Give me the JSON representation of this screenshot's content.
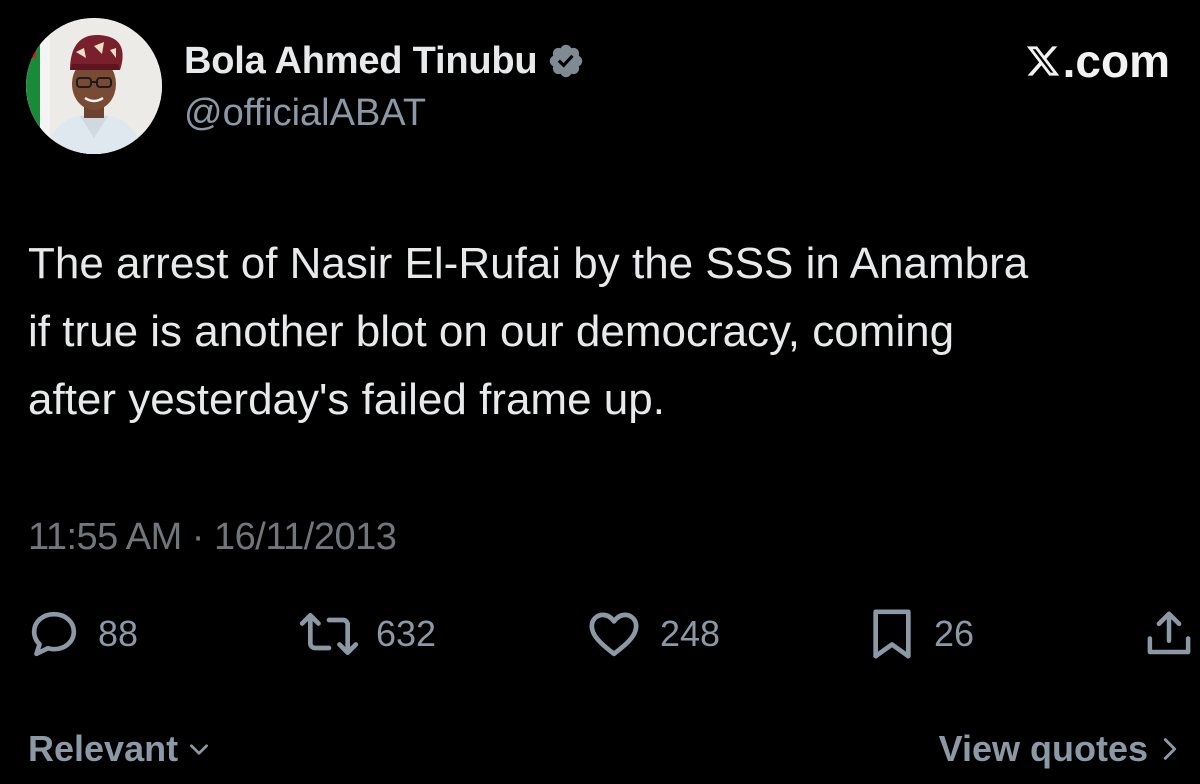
{
  "author": {
    "display_name": "Bola Ahmed Tinubu",
    "handle": "@officialABAT",
    "verified": true,
    "avatar_icon": "profile-photo"
  },
  "source": {
    "label": ".com",
    "logo_icon": "x-logo-icon"
  },
  "tweet": {
    "text": "The arrest of Nasir El-Rufai by the SSS in Anambra\nif true is another blot on our democracy, coming\nafter yesterday's failed frame up."
  },
  "meta": {
    "timestamp": "11:55 AM · 16/11/2013"
  },
  "actions": {
    "reply": {
      "icon": "reply-icon",
      "count": "88"
    },
    "repost": {
      "icon": "repost-icon",
      "count": "632"
    },
    "like": {
      "icon": "heart-icon",
      "count": "248"
    },
    "bookmark": {
      "icon": "bookmark-icon",
      "count": "26"
    },
    "share": {
      "icon": "share-icon"
    }
  },
  "footer": {
    "sort_label": "Relevant",
    "quotes_label": "View quotes"
  },
  "colors": {
    "background": "#000000",
    "primary_text": "#e7e9ea",
    "secondary_text": "#71767b",
    "verified_badge": "#7f8a93"
  }
}
